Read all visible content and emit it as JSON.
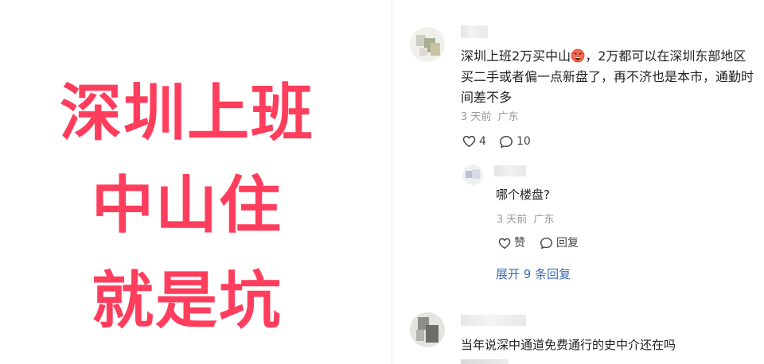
{
  "headline": {
    "line1": "深圳上班",
    "line2": "中山住",
    "line3": "就是坑"
  },
  "comments": [
    {
      "text_before_emoji": "深圳上班2万买中山",
      "text_after_emoji": "，2万都可以在深圳东部地区买二手或者偏一点新盘了，再不济也是本市，通勤时间差不多",
      "emoji": "angry-face-icon",
      "time": "3 天前",
      "location": "广东",
      "likes": "4",
      "replies_count": "10"
    },
    {
      "text": "当年说深中通道免费通行的史中介还在吗"
    }
  ],
  "reply": {
    "text": "哪个楼盘?",
    "time": "3 天前",
    "location": "广东",
    "like_label": "赞",
    "reply_label": "回复"
  },
  "expand_label": "展开 9 条回复",
  "colors": {
    "headline": "#ff3d5c",
    "link": "#3e6db5",
    "meta": "#999999"
  }
}
